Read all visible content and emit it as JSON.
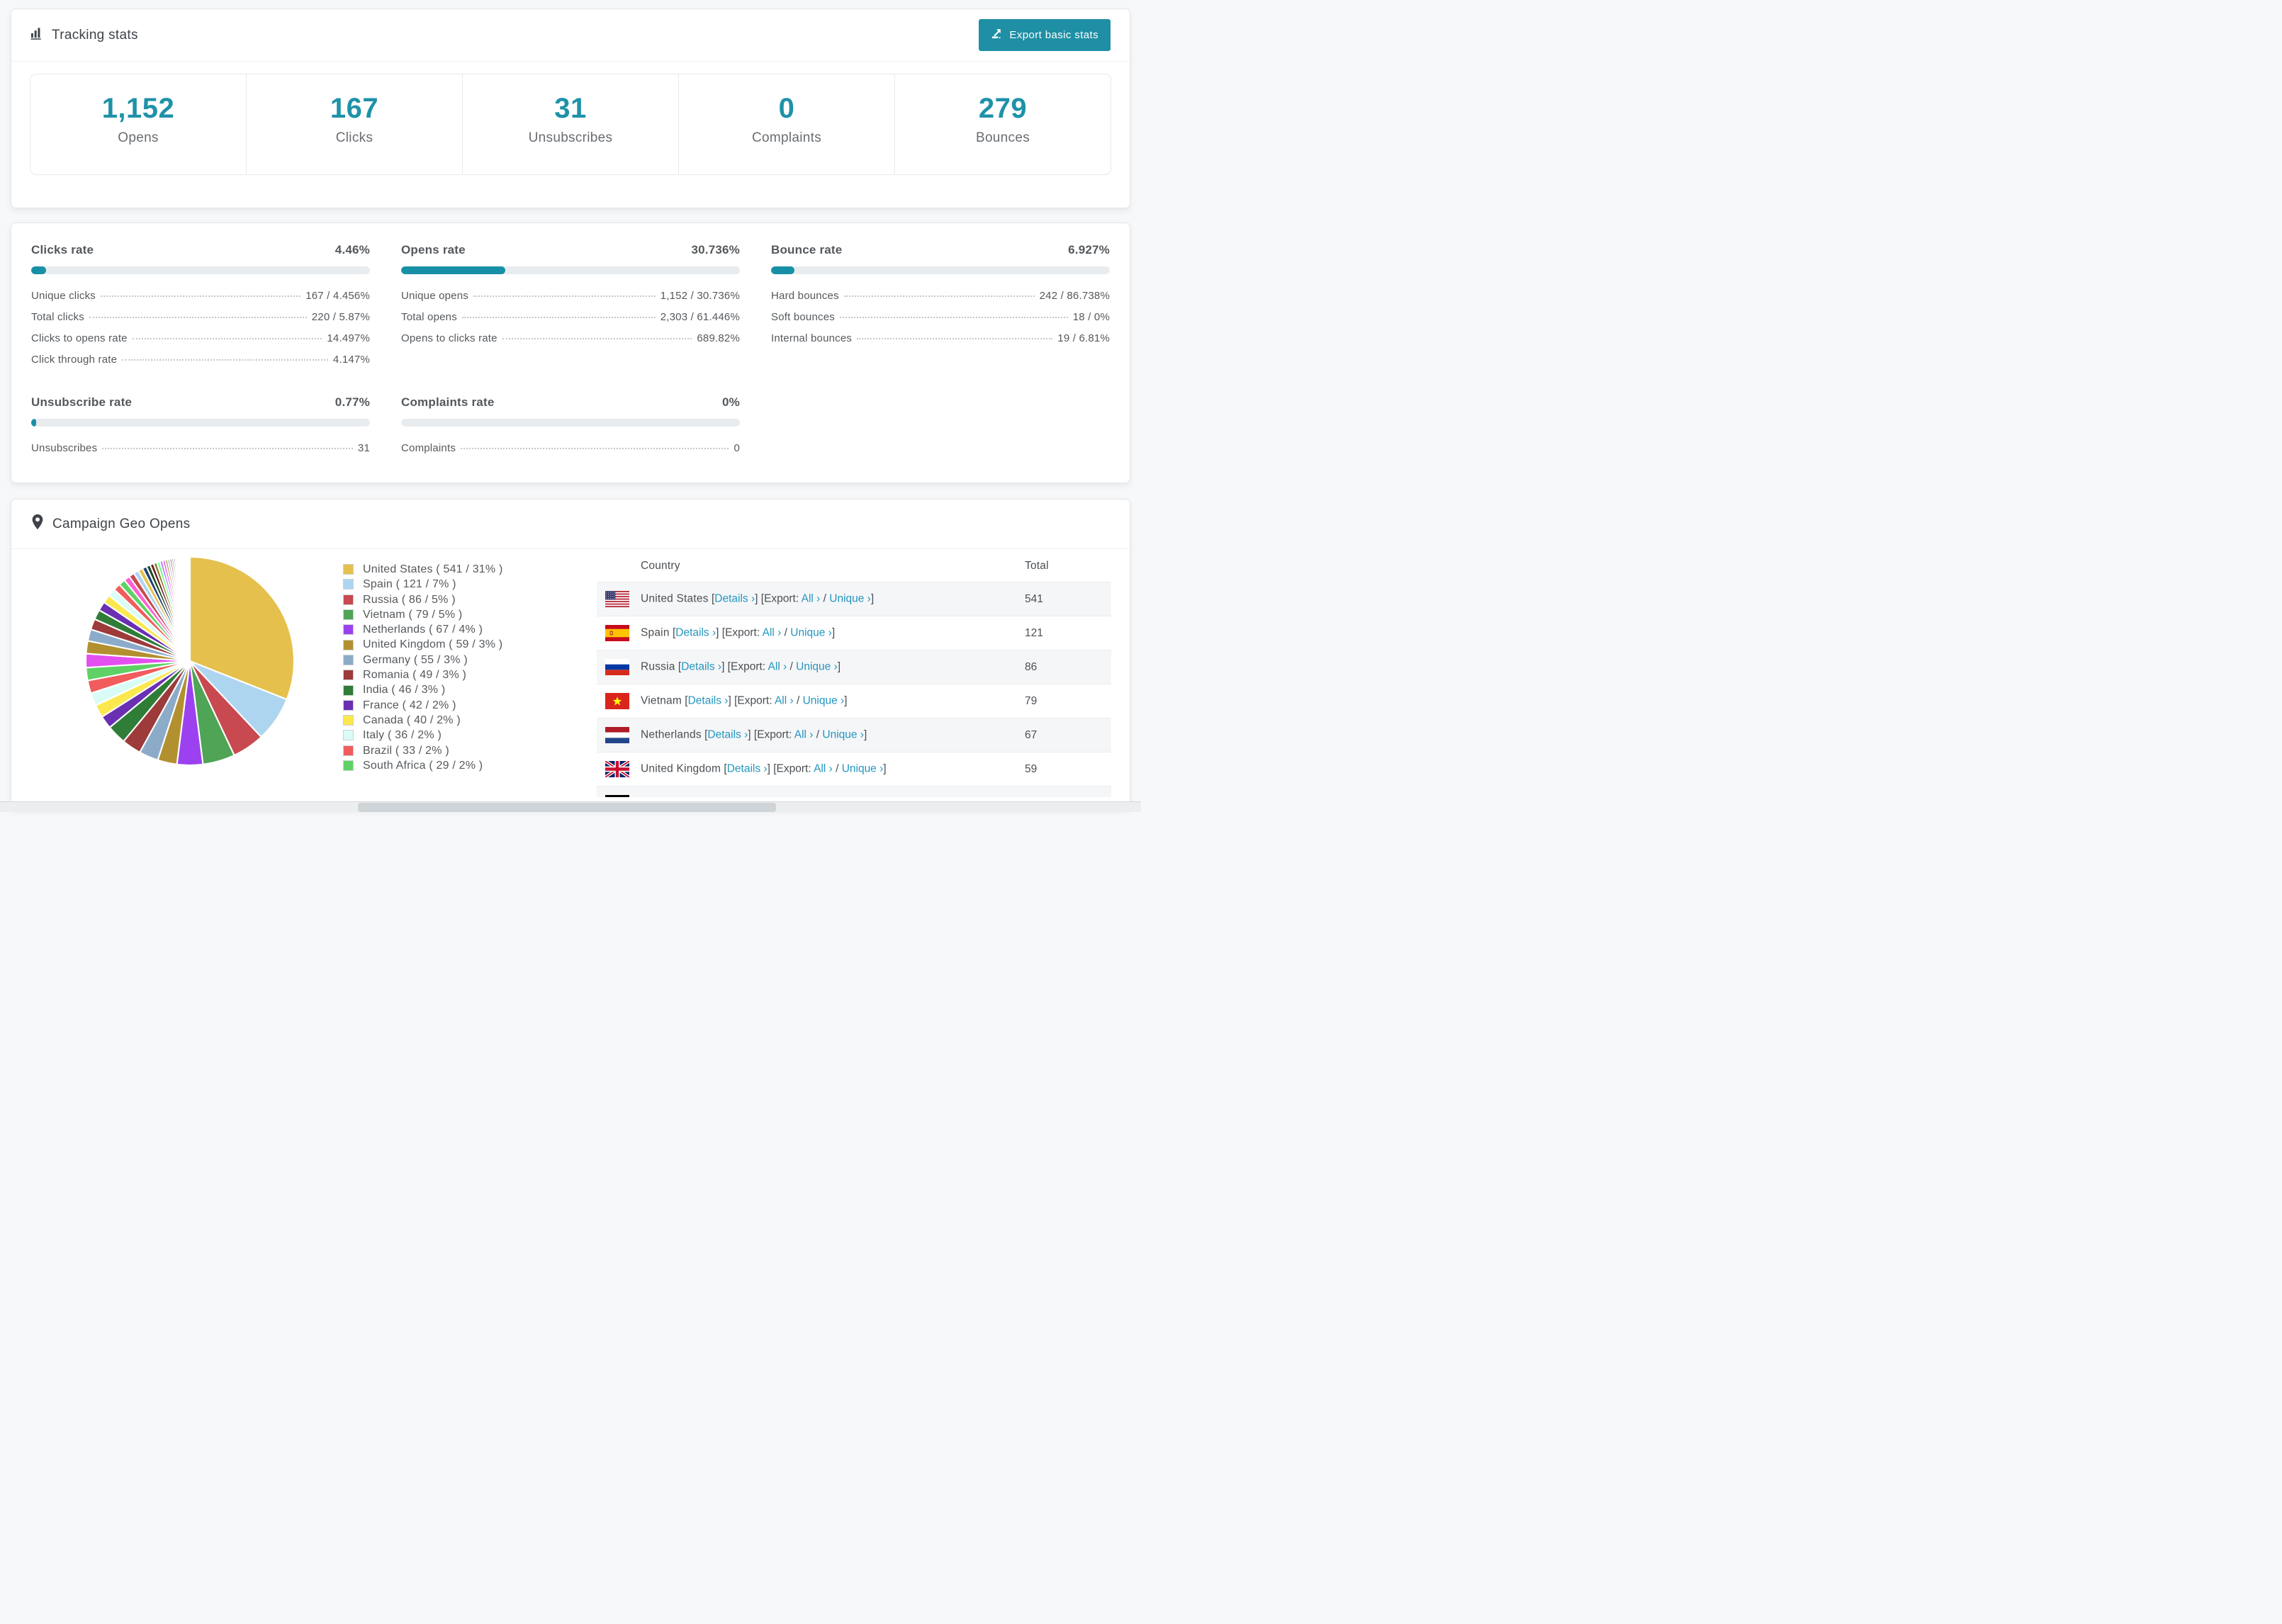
{
  "colors": {
    "accent_teal": "#1e8fa4",
    "number_teal": "#1e92a8",
    "link_teal": "#2496c0",
    "bar_fill": "#1790a6",
    "bar_track": "#e9ecef"
  },
  "header": {
    "title": "Tracking stats",
    "export_label": "Export basic stats"
  },
  "stats": [
    {
      "value": "1,152",
      "label": "Opens"
    },
    {
      "value": "167",
      "label": "Clicks"
    },
    {
      "value": "31",
      "label": "Unsubscribes"
    },
    {
      "value": "0",
      "label": "Complaints"
    },
    {
      "value": "279",
      "label": "Bounces"
    }
  ],
  "rates": [
    {
      "title": "Clicks rate",
      "value": "4.46%",
      "pct": 4.46,
      "rows": [
        [
          "Unique clicks",
          "167 / 4.456%"
        ],
        [
          "Total clicks",
          "220 / 5.87%"
        ],
        [
          "Clicks to opens rate",
          "14.497%"
        ],
        [
          "Click through rate",
          "4.147%"
        ]
      ]
    },
    {
      "title": "Opens rate",
      "value": "30.736%",
      "pct": 30.736,
      "rows": [
        [
          "Unique opens",
          "1,152 / 30.736%"
        ],
        [
          "Total opens",
          "2,303 / 61.446%"
        ],
        [
          "Opens to clicks rate",
          "689.82%"
        ]
      ]
    },
    {
      "title": "Bounce rate",
      "value": "6.927%",
      "pct": 6.927,
      "rows": [
        [
          "Hard bounces",
          "242 / 86.738%"
        ],
        [
          "Soft bounces",
          "18 / 0%"
        ],
        [
          "Internal bounces",
          "19 / 6.81%"
        ]
      ]
    },
    {
      "title": "Unsubscribe rate",
      "value": "0.77%",
      "pct": 0.77,
      "rows": [
        [
          "Unsubscribes",
          "31"
        ]
      ]
    },
    {
      "title": "Complaints rate",
      "value": "0%",
      "pct": 0,
      "rows": [
        [
          "Complaints",
          "0"
        ]
      ]
    }
  ],
  "chart_data": {
    "type": "pie",
    "title": "Campaign Geo Opens",
    "categories": [
      "United States",
      "Spain",
      "Russia",
      "Vietnam",
      "Netherlands",
      "United Kingdom",
      "Germany",
      "Romania",
      "India",
      "France",
      "Canada",
      "Italy",
      "Brazil",
      "South Africa"
    ],
    "values": [
      541,
      121,
      86,
      79,
      67,
      59,
      55,
      49,
      46,
      42,
      40,
      36,
      33,
      29
    ],
    "percents": [
      31,
      7,
      5,
      5,
      4,
      3,
      3,
      3,
      3,
      2,
      2,
      2,
      2,
      2
    ],
    "others_percent": 26,
    "colors": [
      "#e5c04d",
      "#aed5f0",
      "#c8494f",
      "#4fa456",
      "#9b41f0",
      "#b3902f",
      "#8cabc9",
      "#9d3a3a",
      "#2f7d37",
      "#6a2fb3",
      "#fbe84e",
      "#dafcf6",
      "#f15c5c",
      "#5ed264"
    ],
    "others_colors": [
      "#e44ff0",
      "#b3902f",
      "#8cabc9",
      "#9d3a3a",
      "#2f7d37",
      "#6a2fb3",
      "#fbe84e",
      "#dafcf6",
      "#f15c5c",
      "#5ed264",
      "#ff5fd2",
      "#c8494f",
      "#aed5f0",
      "#e5c04d",
      "#23406e",
      "#1d4d25",
      "#6b1f1f",
      "#8a7a25",
      "#66ff84",
      "#b070ff"
    ],
    "legend_format": "{name} ( {value} / {pct}% )",
    "legend_position": "right",
    "start_angle_deg": -90,
    "direction": "clockwise"
  },
  "geo": {
    "title": "Campaign Geo Opens",
    "table": {
      "headers": [
        "Country",
        "Total"
      ],
      "chevron": "›",
      "details_label": "Details",
      "export_prefix": "Export:",
      "all_label": "All",
      "unique_label": "Unique",
      "rows": [
        {
          "flag": "us",
          "country": "United States",
          "total": "541"
        },
        {
          "flag": "es",
          "country": "Spain",
          "total": "121"
        },
        {
          "flag": "ru",
          "country": "Russia",
          "total": "86"
        },
        {
          "flag": "vn",
          "country": "Vietnam",
          "total": "79"
        },
        {
          "flag": "nl",
          "country": "Netherlands",
          "total": "67"
        },
        {
          "flag": "gb",
          "country": "United Kingdom",
          "total": "59"
        },
        {
          "flag": "de",
          "country": "",
          "total": ""
        }
      ]
    }
  }
}
